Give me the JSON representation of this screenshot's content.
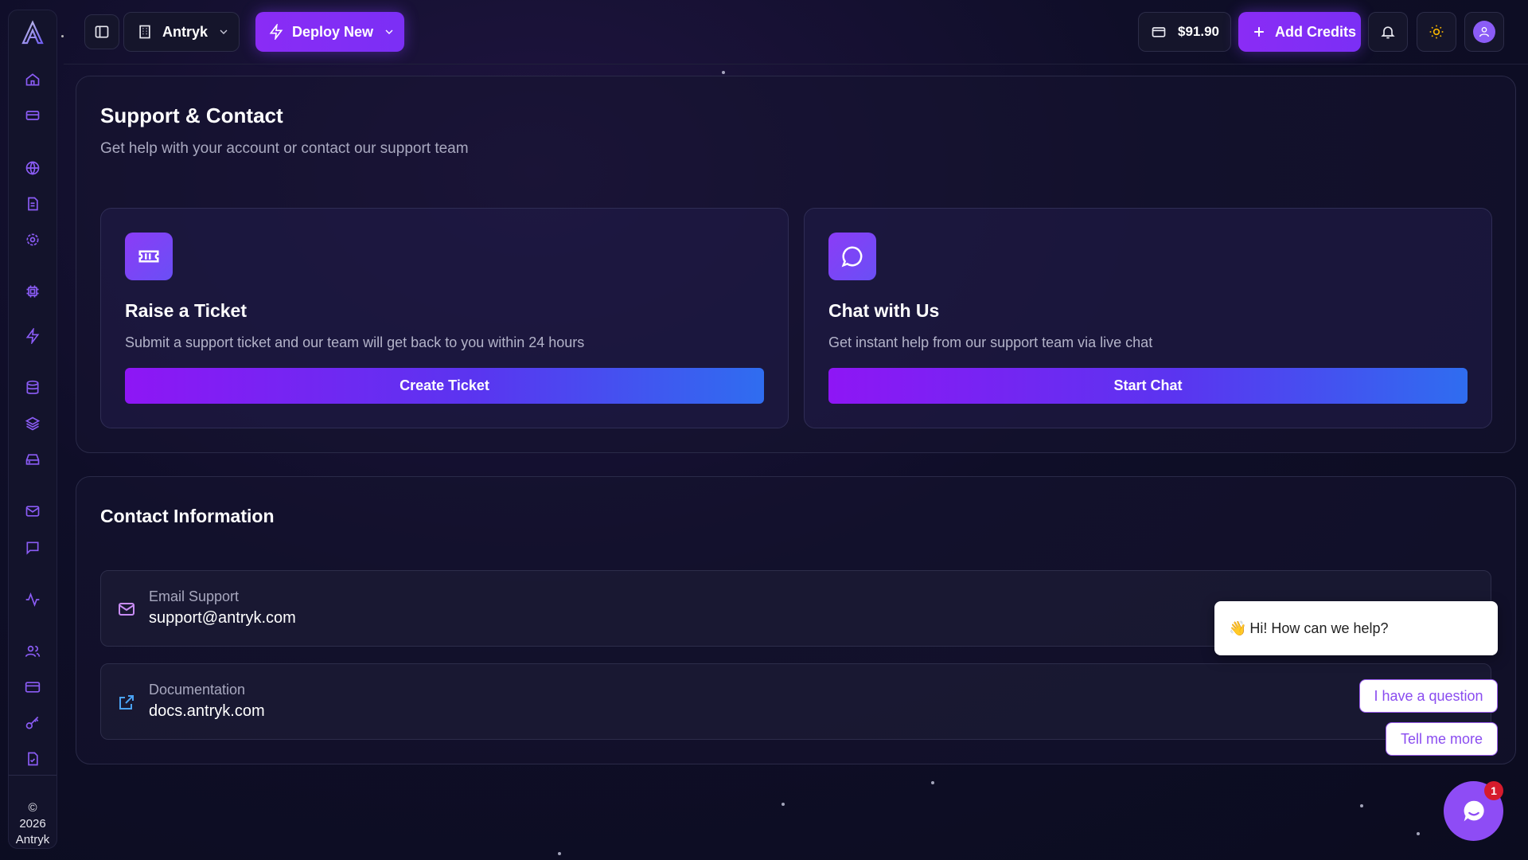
{
  "sidebar": {
    "logo": "antryk-logo",
    "items": [
      {
        "name": "home-icon"
      },
      {
        "name": "server-card-icon"
      },
      {
        "name": "globe-icon"
      },
      {
        "name": "document-icon"
      },
      {
        "name": "settings-icon"
      },
      {
        "name": "cpu-icon"
      },
      {
        "name": "lightning-icon"
      },
      {
        "name": "database-icon"
      },
      {
        "name": "layers-icon"
      },
      {
        "name": "hard-drive-icon"
      },
      {
        "name": "mail-icon"
      },
      {
        "name": "message-icon"
      },
      {
        "name": "activity-icon"
      },
      {
        "name": "users-icon"
      },
      {
        "name": "credit-card-icon"
      },
      {
        "name": "key-icon"
      },
      {
        "name": "file-check-icon"
      }
    ],
    "copyright_symbol": "©",
    "copyright_year": "2026",
    "copyright_name": "Antryk"
  },
  "topbar": {
    "org_name": "Antryk",
    "deploy_label": "Deploy New",
    "balance": "$91.90",
    "add_credits_label": "Add Credits"
  },
  "support": {
    "title": "Support & Contact",
    "subtitle": "Get help with your account or contact our support team",
    "ticket": {
      "title": "Raise a Ticket",
      "description": "Submit a support ticket and our team will get back to you within 24 hours",
      "button": "Create Ticket"
    },
    "chat": {
      "title": "Chat with Us",
      "description": "Get instant help from our support team via live chat",
      "button": "Start Chat"
    }
  },
  "contact": {
    "title": "Contact Information",
    "email_label": "Email Support",
    "email_value": "support@antryk.com",
    "docs_label": "Documentation",
    "docs_value": "docs.antryk.com"
  },
  "chat_widget": {
    "greeting_emoji": "👋",
    "greeting": "Hi! How can we help?",
    "option_1": "I have a question",
    "option_2": "Tell me more",
    "badge_count": "1"
  },
  "colors": {
    "accent": "#8a2cf5",
    "gradient_end": "#2f6df0",
    "background": "#0f0e28",
    "badge": "#d61b2c"
  }
}
